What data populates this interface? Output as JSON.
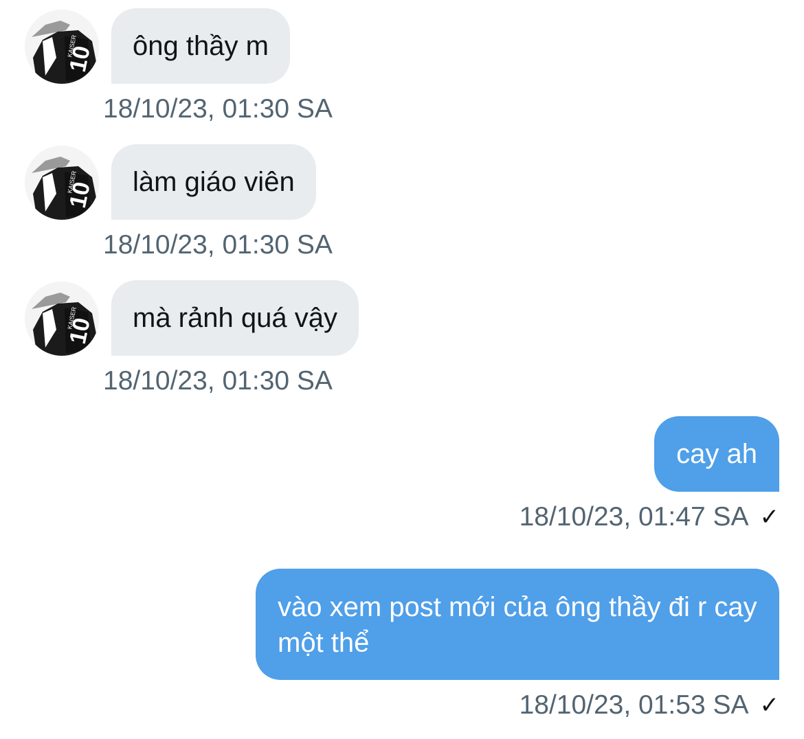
{
  "conversation": {
    "incoming": [
      {
        "text": "ông thầy m",
        "time": "18/10/23, 01:30 SA",
        "avatar_icon": "user-avatar-icon"
      },
      {
        "text": "làm giáo viên",
        "time": "18/10/23, 01:30 SA",
        "avatar_icon": "user-avatar-icon"
      },
      {
        "text": "mà rảnh quá vậy",
        "time": "18/10/23, 01:30 SA",
        "avatar_icon": "user-avatar-icon"
      }
    ],
    "outgoing": [
      {
        "text": "cay ah",
        "time": "18/10/23, 01:47 SA",
        "status_icon": "✓"
      },
      {
        "text": "vào xem post mới của ông thầy đi r cay một thể",
        "time": "18/10/23, 01:53 SA",
        "status_icon": "✓"
      }
    ]
  },
  "colors": {
    "incoming_bubble": "#e8ecef",
    "outgoing_bubble": "#4f9fe9",
    "timestamp": "#536471"
  }
}
